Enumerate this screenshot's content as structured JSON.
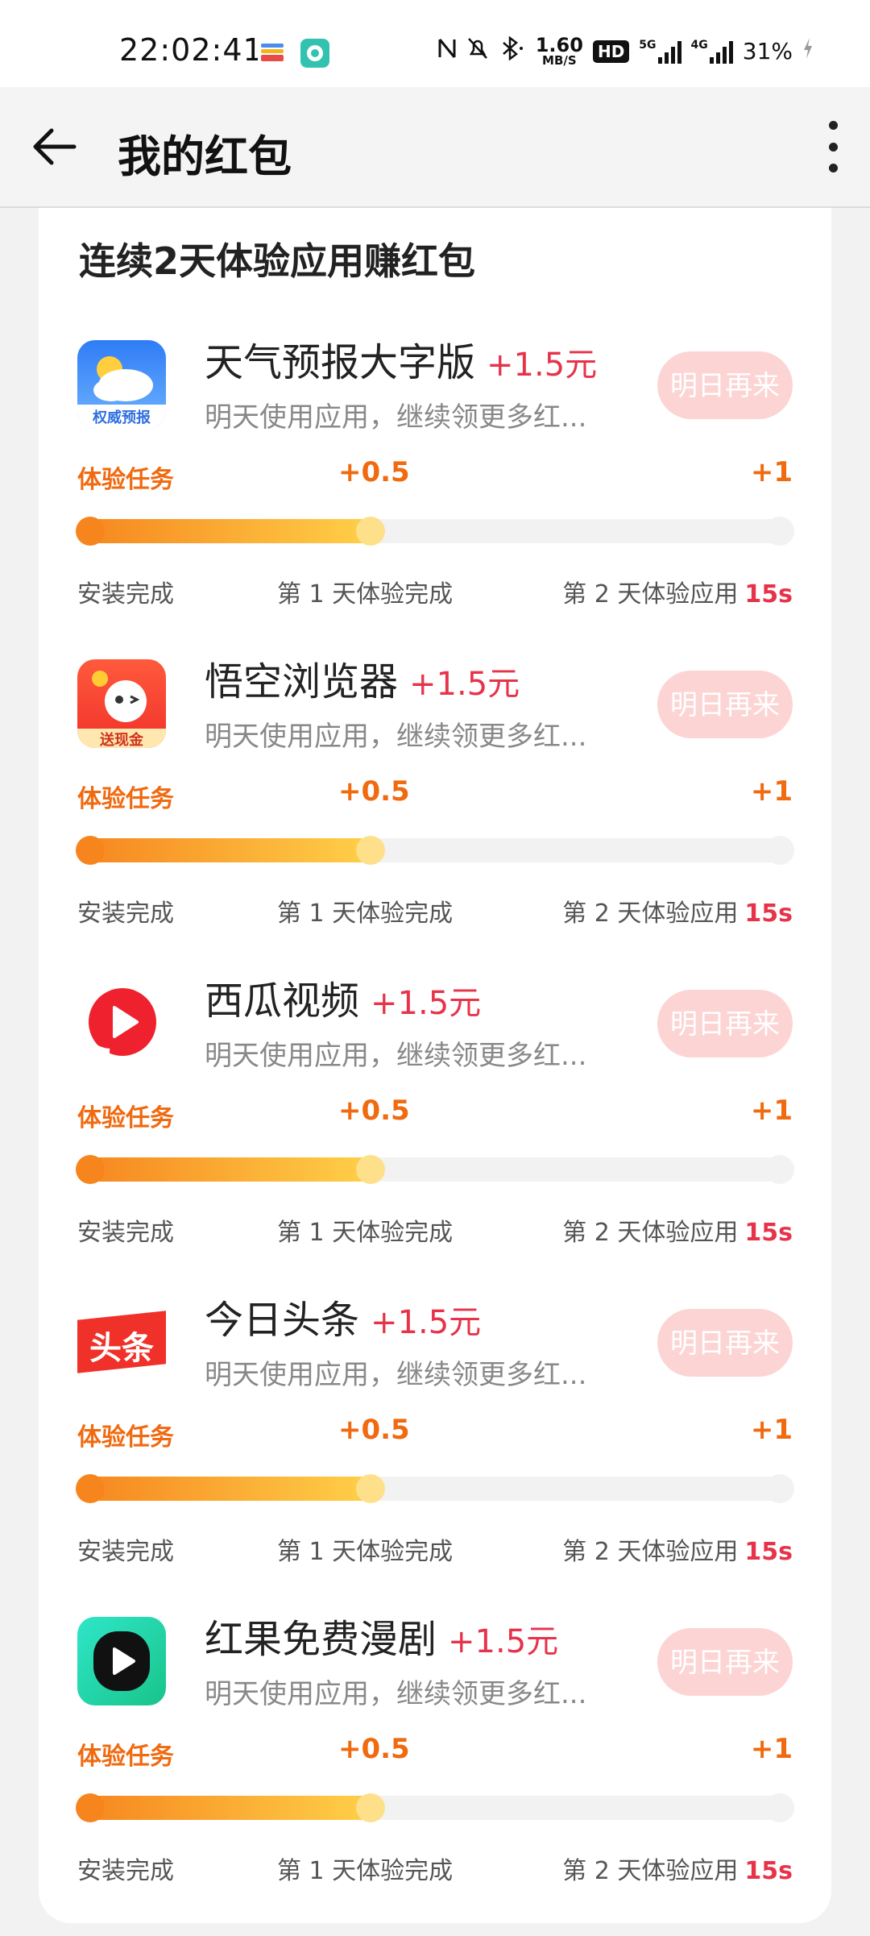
{
  "status_bar": {
    "time": "22:02:41",
    "net_speed": "1.60",
    "net_unit": "MB/S",
    "hd_label": "HD",
    "sig1_tag": "5G",
    "sig2_tag": "4G",
    "battery": "31%"
  },
  "header": {
    "title": "我的红包"
  },
  "section": {
    "title": "连续2天体验应用赚红包"
  },
  "tasks": [
    {
      "name": "天气预报大字版",
      "reward": "+1.5元",
      "desc": "明天使用应用，继续领更多红...",
      "button": "明日再来",
      "icon": "weather-app-icon",
      "icon_caption": "权威预报",
      "task_label": "体验任务",
      "mid_reward": "+0.5",
      "end_reward": "+1",
      "step1": "安装完成",
      "step2": "第 1 天体验完成",
      "step3": "第 2 天体验应用",
      "step3_time": "15s",
      "progress": 0.5
    },
    {
      "name": "悟空浏览器",
      "reward": "+1.5元",
      "desc": "明天使用应用，继续领更多红...",
      "button": "明日再来",
      "icon": "wukong-browser-icon",
      "icon_caption": "送现金",
      "task_label": "体验任务",
      "mid_reward": "+0.5",
      "end_reward": "+1",
      "step1": "安装完成",
      "step2": "第 1 天体验完成",
      "step3": "第 2 天体验应用",
      "step3_time": "15s",
      "progress": 0.5
    },
    {
      "name": "西瓜视频",
      "reward": "+1.5元",
      "desc": "明天使用应用，继续领更多红...",
      "button": "明日再来",
      "icon": "xigua-video-icon",
      "task_label": "体验任务",
      "mid_reward": "+0.5",
      "end_reward": "+1",
      "step1": "安装完成",
      "step2": "第 1 天体验完成",
      "step3": "第 2 天体验应用",
      "step3_time": "15s",
      "progress": 0.5
    },
    {
      "name": "今日头条",
      "reward": "+1.5元",
      "desc": "明天使用应用，继续领更多红...",
      "button": "明日再来",
      "icon": "toutiao-icon",
      "icon_caption": "头条",
      "task_label": "体验任务",
      "mid_reward": "+0.5",
      "end_reward": "+1",
      "step1": "安装完成",
      "step2": "第 1 天体验完成",
      "step3": "第 2 天体验应用",
      "step3_time": "15s",
      "progress": 0.5
    },
    {
      "name": "红果免费漫剧",
      "reward": "+1.5元",
      "desc": "明天使用应用，继续领更多红...",
      "button": "明日再来",
      "icon": "hongguo-icon",
      "task_label": "体验任务",
      "mid_reward": "+0.5",
      "end_reward": "+1",
      "step1": "安装完成",
      "step2": "第 1 天体验完成",
      "step3": "第 2 天体验应用",
      "step3_time": "15s",
      "progress": 0.5
    }
  ],
  "colors": {
    "accent_red": "#e6334a",
    "accent_orange": "#f06a10",
    "button_disabled": "#fcd4d4"
  }
}
